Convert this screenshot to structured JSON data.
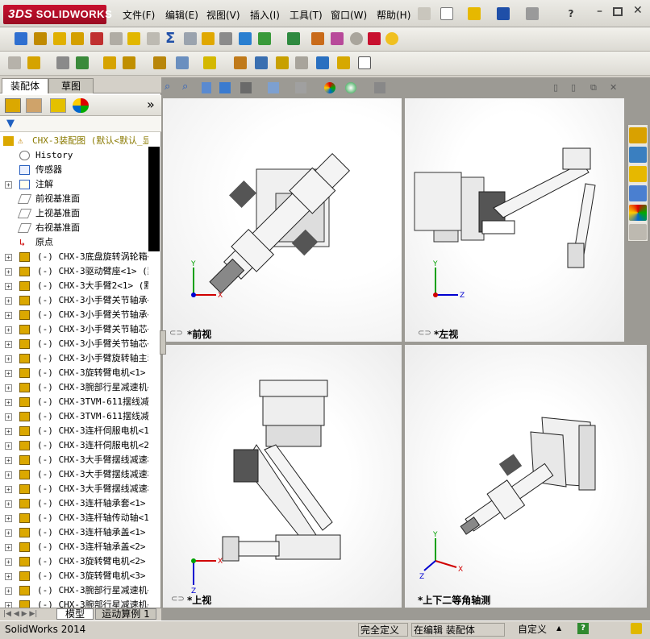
{
  "app": {
    "logo_prefix": "3DS",
    "logo_text": "SOLIDWORKS"
  },
  "menu": [
    "文件(F)",
    "编辑(E)",
    "视图(V)",
    "插入(I)",
    "工具(T)",
    "窗口(W)",
    "帮助(H)"
  ],
  "panel_tabs": {
    "assembly": "装配体",
    "sketch": "草图"
  },
  "tree": {
    "root": "CHX-3装配图  (默认<默认_显",
    "items": [
      "History",
      "传感器",
      "注解",
      "前视基准面",
      "上视基准面",
      "右视基准面",
      "原点"
    ],
    "components": [
      "(-) CHX-3底盘旋转涡轮箱<1>",
      "(-) CHX-3驱动臂座<1> (默认",
      "(-) CHX-3大手臂2<1> (默认<",
      "(-) CHX-3小手臂关节轴承<1>",
      "(-) CHX-3小手臂关节轴承<2>",
      "(-) CHX-3小手臂关节轴芯<1>",
      "(-) CHX-3小手臂关节轴芯<2>",
      "(-) CHX-3小手臂旋转轴主动轴",
      "(-) CHX-3旋转臂电机<1> (默",
      "(-) CHX-3腕部行星减速机<1>",
      "(-) CHX-3TVM-611摆线减速机",
      "(-) CHX-3TVM-611摆线减速机",
      "(-) CHX-3连杆伺服电机<1> (",
      "(-) CHX-3连杆伺服电机<2> (",
      "(-) CHX-3大手臂摆线减速机安",
      "(-) CHX-3大手臂摆线减速机安",
      "(-) CHX-3大手臂摆线减速机主",
      "(-) CHX-3连杆轴承套<1> (默",
      "(-) CHX-3连杆轴传动轴<1> (",
      "(-) CHX-3连杆轴承盖<1> (默",
      "(-) CHX-3连杆轴承盖<2> (默",
      "(-) CHX-3旋转臂电机<2> (默",
      "(-) CHX-3旋转臂电机<3> (默",
      "(-) CHX-3腕部行星减速机<2>",
      "(-) CHX-3腕部行星减速机<3>"
    ]
  },
  "viewports": {
    "front": "*前视",
    "left": "*左视",
    "top": "*上视",
    "iso": "*上下二等角轴测"
  },
  "bottom_tabs": {
    "model": "模型",
    "motion": "运动算例 1"
  },
  "status": {
    "app": "SolidWorks 2014",
    "defined": "完全定义",
    "editing": "在编辑 装配体",
    "custom": "自定义"
  },
  "colors": {
    "brand": "#c8102e",
    "axis_x": "#d00000",
    "axis_y": "#00a000",
    "axis_z": "#0000d0"
  }
}
